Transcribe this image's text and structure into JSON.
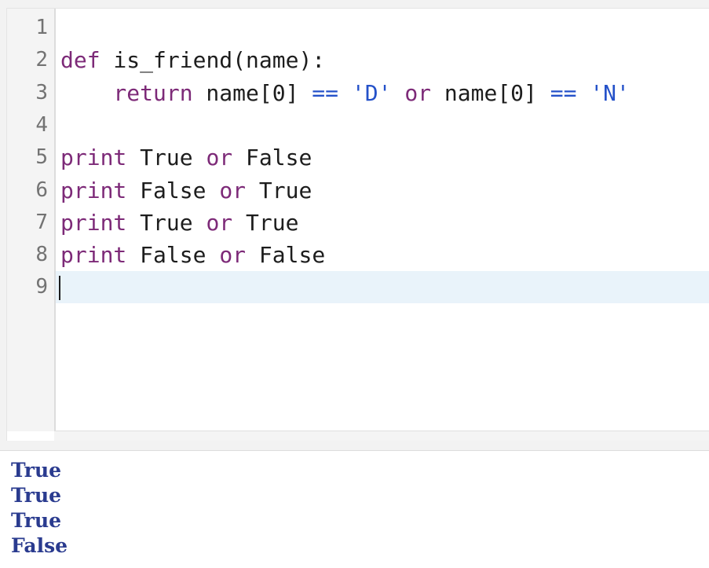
{
  "editor": {
    "line_numbers": [
      "1",
      "2",
      "3",
      "4",
      "5",
      "6",
      "7",
      "8",
      "9"
    ],
    "lines": [
      {
        "tokens": []
      },
      {
        "tokens": [
          {
            "text": "def",
            "type": "kw"
          },
          {
            "text": " is_friend(name):",
            "type": "plain"
          }
        ]
      },
      {
        "tokens": [
          {
            "text": "    return",
            "type": "kw"
          },
          {
            "text": " name[0] ",
            "type": "plain"
          },
          {
            "text": "==",
            "type": "op"
          },
          {
            "text": " ",
            "type": "plain"
          },
          {
            "text": "'D'",
            "type": "str"
          },
          {
            "text": " ",
            "type": "plain"
          },
          {
            "text": "or",
            "type": "kw-or"
          },
          {
            "text": " name[0] ",
            "type": "plain"
          },
          {
            "text": "==",
            "type": "op"
          },
          {
            "text": " ",
            "type": "plain"
          },
          {
            "text": "'N'",
            "type": "str"
          }
        ]
      },
      {
        "tokens": []
      },
      {
        "tokens": [
          {
            "text": "print",
            "type": "kw"
          },
          {
            "text": " True ",
            "type": "plain"
          },
          {
            "text": "or",
            "type": "kw-or"
          },
          {
            "text": " False",
            "type": "plain"
          }
        ]
      },
      {
        "tokens": [
          {
            "text": "print",
            "type": "kw"
          },
          {
            "text": " False ",
            "type": "plain"
          },
          {
            "text": "or",
            "type": "kw-or"
          },
          {
            "text": " True",
            "type": "plain"
          }
        ]
      },
      {
        "tokens": [
          {
            "text": "print",
            "type": "kw"
          },
          {
            "text": " True ",
            "type": "plain"
          },
          {
            "text": "or",
            "type": "kw-or"
          },
          {
            "text": " True",
            "type": "plain"
          }
        ]
      },
      {
        "tokens": [
          {
            "text": "print",
            "type": "kw"
          },
          {
            "text": " False ",
            "type": "plain"
          },
          {
            "text": "or",
            "type": "kw-or"
          },
          {
            "text": " False",
            "type": "plain"
          }
        ]
      },
      {
        "tokens": []
      }
    ],
    "current_line": 9
  },
  "output": {
    "lines": [
      "True",
      "True",
      "True",
      "False"
    ]
  },
  "colors": {
    "keyword": "#7d2a78",
    "string": "#2451c9",
    "operator": "#2451c9",
    "output_text": "#2a3b8f",
    "current_line_bg": "#e9f3fa"
  }
}
